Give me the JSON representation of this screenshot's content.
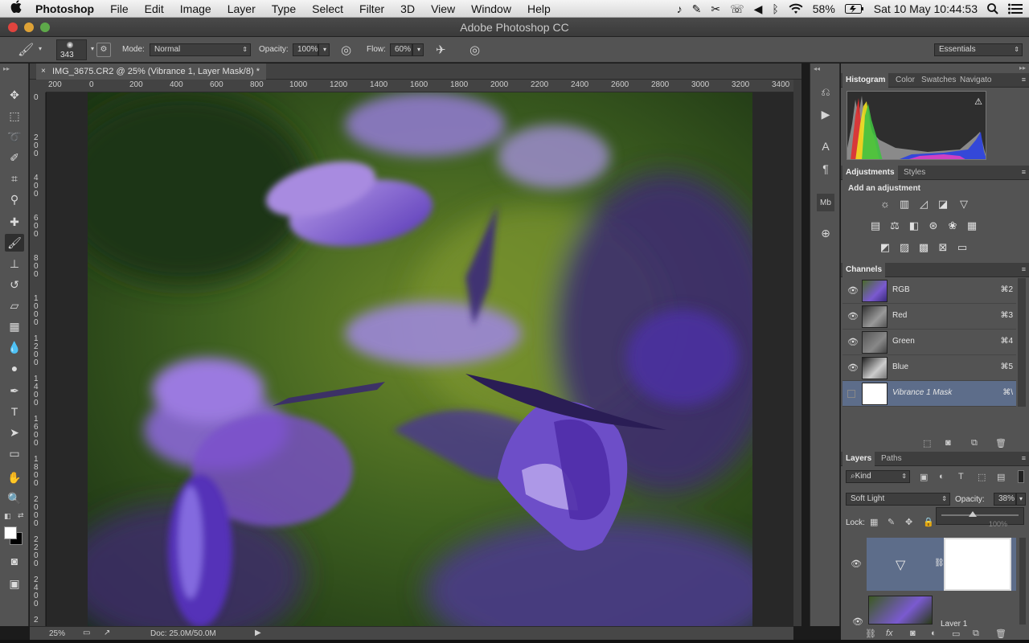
{
  "menubar": {
    "app_name": "Photoshop",
    "items": [
      "File",
      "Edit",
      "Image",
      "Layer",
      "Type",
      "Select",
      "Filter",
      "3D",
      "View",
      "Window",
      "Help"
    ],
    "battery": "58%",
    "datetime": "Sat 10 May  10:44:53"
  },
  "window": {
    "title": "Adobe Photoshop CC"
  },
  "options_bar": {
    "brush_size": "343",
    "mode_label": "Mode:",
    "mode_value": "Normal",
    "opacity_label": "Opacity:",
    "opacity_value": "100%",
    "flow_label": "Flow:",
    "flow_value": "60%",
    "workspace": "Essentials"
  },
  "document": {
    "tab_title": "IMG_3675.CR2 @ 25% (Vibrance 1, Layer Mask/8) *",
    "ruler_h": [
      "200",
      "0",
      "200",
      "400",
      "600",
      "800",
      "1000",
      "1200",
      "1400",
      "1600",
      "1800",
      "2000",
      "2200",
      "2400",
      "2600",
      "2800",
      "3000",
      "3200",
      "3400"
    ],
    "ruler_v": [
      "0",
      "2 0 0",
      "4 0 0",
      "6 0 0",
      "8 0 0",
      "1 0 0 0",
      "1 2 0 0",
      "1 4 0 0",
      "1 6 0 0",
      "1 8 0 0",
      "2 0 0 0",
      "2 2 0 0",
      "2 4 0 0",
      "2"
    ],
    "zoom": "25%",
    "doc_size": "Doc: 25.0M/50.0M"
  },
  "panels": {
    "top_tabs": [
      "Histogram",
      "Color",
      "Swatches",
      "Navigato"
    ],
    "adjust_tabs": [
      "Adjustments",
      "Styles"
    ],
    "add_adjustment": "Add an adjustment",
    "channels_tab": "Channels",
    "channels": [
      {
        "name": "RGB",
        "shortcut": "⌘2"
      },
      {
        "name": "Red",
        "shortcut": "⌘3"
      },
      {
        "name": "Green",
        "shortcut": "⌘4"
      },
      {
        "name": "Blue",
        "shortcut": "⌘5"
      },
      {
        "name": "Vibrance 1 Mask",
        "shortcut": "⌘\\"
      }
    ],
    "layers_tabs": [
      "Layers",
      "Paths"
    ],
    "kind_filter": "Kind",
    "blend_mode": "Soft Light",
    "opacity_label": "Opacity:",
    "opacity_value": "38%",
    "lock_label": "Lock:",
    "fill_partial": "100%",
    "layer2_name": "Layer 1"
  },
  "colors": {
    "chrome": "#535353",
    "selected_row": "#5d6d8a"
  }
}
